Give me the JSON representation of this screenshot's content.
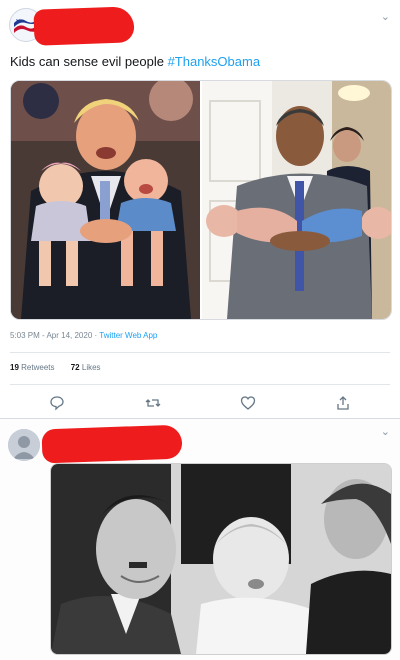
{
  "tweet1": {
    "text": "Kids can sense evil people",
    "hashtag": "#ThanksObama",
    "timestamp": "5:03 PM - Apr 14, 2020",
    "separator": " · ",
    "source": "Twitter Web App",
    "retweets_count": "19",
    "retweets_label": "Retweets",
    "likes_count": "72",
    "likes_label": "Likes",
    "actions": [
      "reply-icon",
      "retweet-icon",
      "like-icon",
      "share-icon"
    ]
  },
  "tweet2": {
    "actions": [
      "chevron-down-icon"
    ]
  },
  "colors": {
    "accent": "#1da1f2",
    "redaction": "#ee1c1c",
    "muted": "#657786"
  }
}
